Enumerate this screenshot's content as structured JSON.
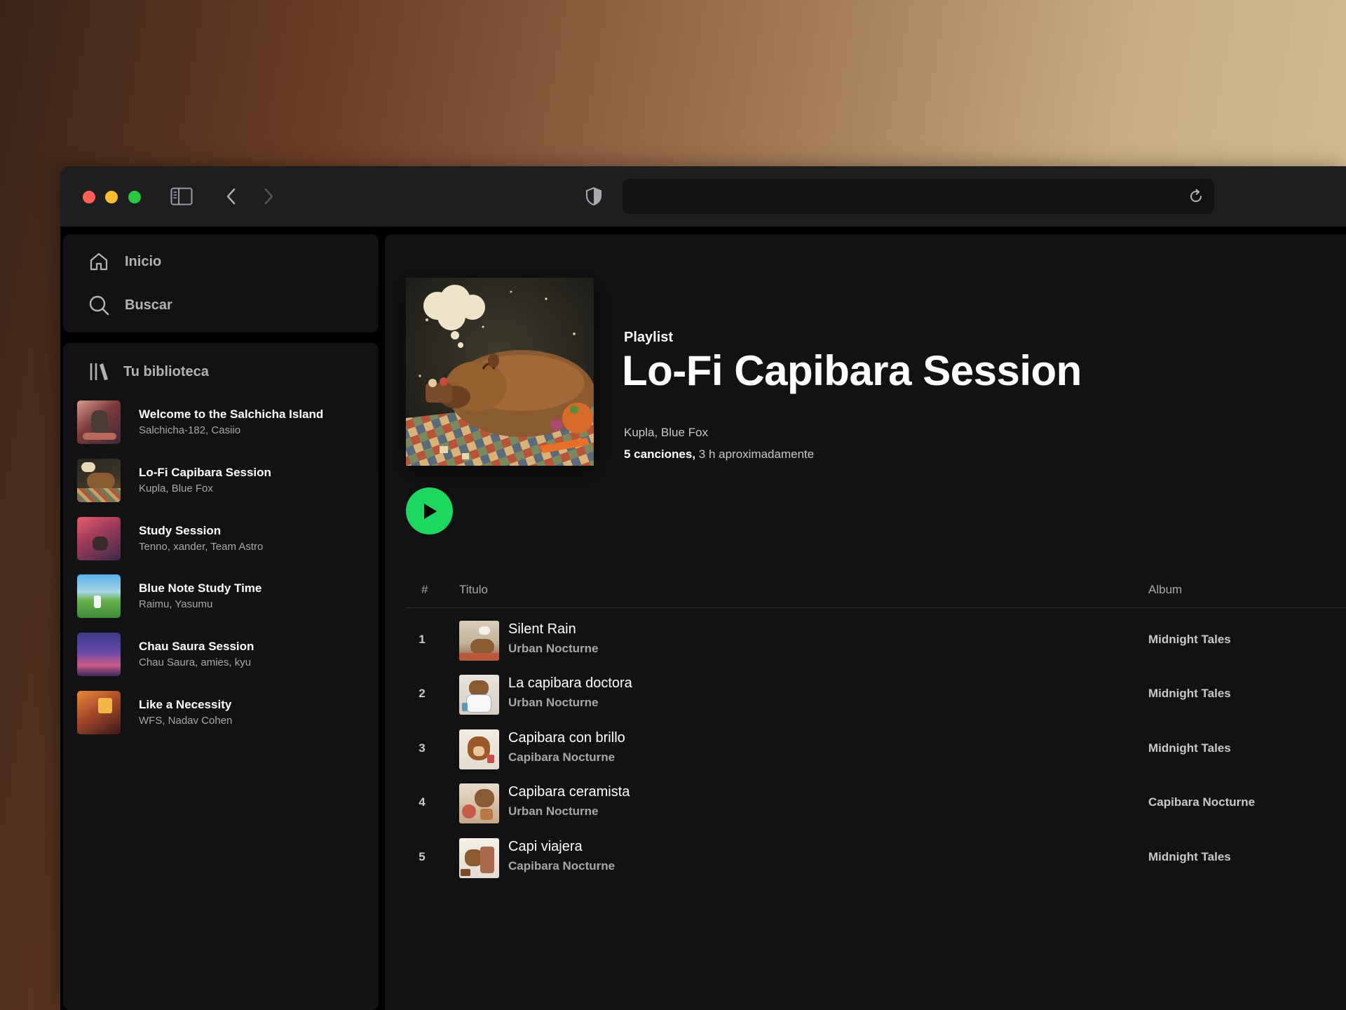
{
  "browser": {
    "sidebar_toggle_icon": "sidebar-icon",
    "back_icon": "chevron-left-icon",
    "forward_icon": "chevron-right-icon",
    "shield_icon": "shield-icon",
    "reload_icon": "reload-icon"
  },
  "nav": {
    "home_label": "Inicio",
    "search_label": "Buscar"
  },
  "library": {
    "title": "Tu biblioteca",
    "items": [
      {
        "title": "Welcome to the Salchicha Island",
        "subtitle": "Salchicha-182, Casiio"
      },
      {
        "title": "Lo-Fi Capibara Session",
        "subtitle": "Kupla, Blue Fox"
      },
      {
        "title": "Study Session",
        "subtitle": "Tenno, xander, Team Astro"
      },
      {
        "title": "Blue Note Study Time",
        "subtitle": "Raimu, Yasumu"
      },
      {
        "title": "Chau Saura Session",
        "subtitle": "Chau Saura, amies, kyu"
      },
      {
        "title": "Like a Necessity",
        "subtitle": "WFS, Nadav Cohen"
      }
    ]
  },
  "playlist": {
    "type": "Playlist",
    "title": "Lo-Fi Capibara Session",
    "artists": "Kupla, Blue Fox",
    "meta_count": "5 canciones,",
    "meta_duration": " 3 h aproximadamente"
  },
  "table": {
    "col_num": "#",
    "col_title": "Titulo",
    "col_album": "Album",
    "rows": [
      {
        "num": "1",
        "title": "Silent Rain",
        "artist": "Urban Nocturne",
        "album": "Midnight Tales"
      },
      {
        "num": "2",
        "title": "La capibara doctora",
        "artist": "Urban Nocturne",
        "album": "Midnight Tales"
      },
      {
        "num": "3",
        "title": "Capibara con brillo",
        "artist": "Capibara Nocturne",
        "album": "Midnight Tales"
      },
      {
        "num": "4",
        "title": "Capibara ceramista",
        "artist": "Urban Nocturne",
        "album": "Capibara Nocturne"
      },
      {
        "num": "5",
        "title": "Capi viajera",
        "artist": "Capibara Nocturne",
        "album": "Midnight Tales"
      }
    ]
  },
  "colors": {
    "accent_green": "#1ed760",
    "panel": "#121214",
    "titlebar": "#1e1e21"
  }
}
